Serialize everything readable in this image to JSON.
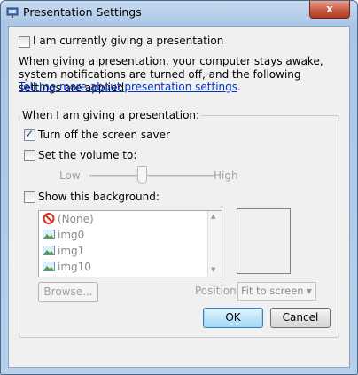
{
  "window": {
    "title": "Presentation Settings",
    "close_glyph": "x"
  },
  "main": {
    "giving_presentation_label": "I am currently giving a presentation",
    "giving_presentation_checked": false,
    "description": "When giving a presentation, your computer stays awake, system notifications are turned off, and the following settings are applied.",
    "link_text": "Tell me more about presentation settings",
    "link_suffix": "."
  },
  "group": {
    "title": "When I am giving a presentation:",
    "screensaver_label": "Turn off the screen saver",
    "screensaver_checked": true,
    "volume_label": "Set the volume to:",
    "volume_checked": false,
    "volume_low": "Low",
    "volume_high": "High",
    "volume_level_fraction": 0.42,
    "background_label": "Show this background:",
    "background_checked": false,
    "backgrounds": [
      {
        "label": "(None)",
        "icon": "no-entry-icon"
      },
      {
        "label": "img0",
        "icon": "image-icon"
      },
      {
        "label": "img1",
        "icon": "image-icon"
      },
      {
        "label": "img10",
        "icon": "image-icon"
      }
    ],
    "browse_label": "Browse...",
    "position_label": "Position:",
    "position_value": "Fit to screen"
  },
  "footer": {
    "ok_label": "OK",
    "cancel_label": "Cancel"
  },
  "colors": {
    "link": "#0033cc",
    "titlebar": "#a9c6e6",
    "close_button": "#c75a3f"
  }
}
